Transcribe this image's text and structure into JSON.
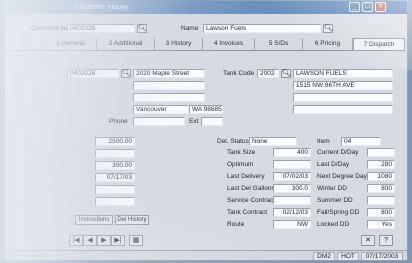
{
  "window": {
    "title": "Customer Inquiry",
    "buttons": {
      "minimize": "_",
      "maximize": "□",
      "close": "✕"
    }
  },
  "header": {
    "account_label": "Customer No.",
    "account_value": "0402026",
    "name_label": "Name",
    "name_value": "Lawson Fuels"
  },
  "tabs": [
    {
      "label": "1 General"
    },
    {
      "label": "2 Additional"
    },
    {
      "label": "3 History"
    },
    {
      "label": "4 Invoices"
    },
    {
      "label": "5 S/Ds"
    },
    {
      "label": "6 Pricing"
    },
    {
      "label": "7 Dispatch"
    }
  ],
  "address": {
    "delivery_code": "0402026",
    "street": "2020 Maple Street",
    "line2": "",
    "line3": "",
    "city": "Vancouver",
    "state_zip": "WA 98685",
    "phone_label": "Phone",
    "phone_value": "",
    "ext_label": "Ext"
  },
  "tank": {
    "code_label": "Tank Code",
    "code_value": "2002",
    "company": "LAWSON FUELS",
    "address": "1515 NW 86TH AVE",
    "line3": "",
    "line4": ""
  },
  "left_values": [
    {
      "label": "",
      "value": "2500.00"
    },
    {
      "label": "",
      "value": ""
    },
    {
      "label": "",
      "value": "300.00"
    },
    {
      "label": "",
      "value": "07/17/03"
    },
    {
      "label": "",
      "value": ""
    },
    {
      "label": "",
      "value": ""
    }
  ],
  "left_buttons": {
    "b1": "Instructions",
    "b2": "Del History"
  },
  "dispatch": {
    "del_status_label": "Del. Status",
    "del_status_value": "None",
    "item_label": "Item",
    "item_value": "04",
    "rows_left": [
      {
        "label": "Tank Size",
        "value": "400"
      },
      {
        "label": "Optimum",
        "value": ""
      },
      {
        "label": "Last Delivery",
        "value": "07/02/03"
      },
      {
        "label": "Last Del Gallons",
        "value": "300.0"
      },
      {
        "label": "Service Contract",
        "value": ""
      },
      {
        "label": "Tank Contract",
        "value": "02/12/03"
      },
      {
        "label": "Route",
        "value": "NW"
      }
    ],
    "rows_right": [
      {
        "label": "Current D/Day",
        "value": ""
      },
      {
        "label": "Last D/Day",
        "value": "280"
      },
      {
        "label": "Next Degree Day",
        "value": "1080"
      },
      {
        "label": "Winter DD",
        "value": "800"
      },
      {
        "label": "Summer DD",
        "value": ""
      },
      {
        "label": "Fall/Spring DD",
        "value": "800"
      },
      {
        "label": "Locked DD",
        "value": "Yes"
      }
    ]
  },
  "nav": {
    "first": "|◀",
    "prev": "◀",
    "next": "▶",
    "last": "▶|",
    "grid": "▦",
    "close_x": "✕",
    "help": "?"
  },
  "status": {
    "mode": "DM2",
    "key": "HOT",
    "date": "07/17/2003"
  },
  "colors": {
    "titlebar": "#6d91bd",
    "close_button": "#d65a3a",
    "window_bg": "#d7dbe1"
  }
}
